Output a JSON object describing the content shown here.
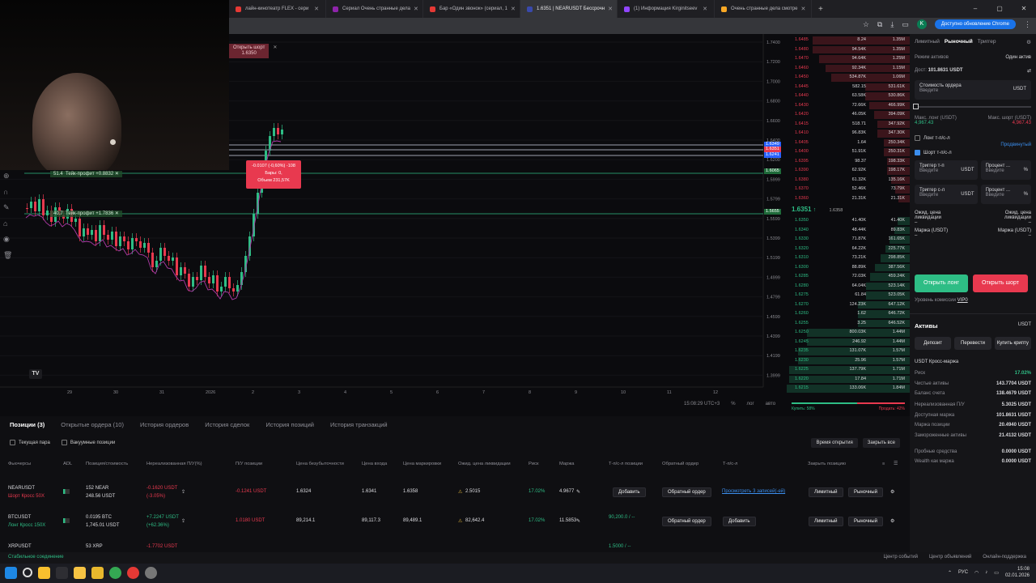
{
  "browser": {
    "tabs": [
      {
        "label": "лайн-кинотеатр FLEX - сери",
        "color": "#e53935",
        "active": false
      },
      {
        "label": "Сериал Очень странные дела",
        "color": "#8e24aa",
        "active": false
      },
      {
        "label": "Бар «Один звонок» (сериал, 1",
        "color": "#e53935",
        "active": false
      },
      {
        "label": "1.6351 | NEARUSDT Бессрочн",
        "color": "#3949ab",
        "active": true
      },
      {
        "label": "(1) Информация Kirginitseev",
        "color": "#9146ff",
        "active": false
      },
      {
        "label": "Очень странные дела смотре",
        "color": "#f9a825",
        "active": false
      }
    ],
    "new_tab_icon": "plus-icon",
    "update_label": "Доступно обновление Chrome",
    "profile_letter": "K"
  },
  "chart": {
    "open_short_label": "Открыть шорт",
    "open_short_price": "1.6350",
    "tooltip": {
      "line1": "-0.0107 (-0,60%) -108",
      "line2": "Бары: 0,",
      "line3": "Объем 231,57K"
    },
    "take_profit_1": {
      "qty": "51.4",
      "label": "Тейк-профит +0.8832"
    },
    "take_profit_2": {
      "qty": "40.7",
      "label": "Тейк-профит +1.7836"
    },
    "y_ticks": [
      "1.7400",
      "1.7200",
      "1.7000",
      "1.6800",
      "1.6600",
      "1.6400",
      "1.6200",
      "1.5999",
      "1.5799",
      "1.5599",
      "1.5399",
      "1.5199",
      "1.4999",
      "1.4799",
      "1.4599",
      "1.4399",
      "1.4199",
      "1.3999"
    ],
    "x_ticks": [
      "29",
      "30",
      "31",
      "2026",
      "2",
      "3",
      "4",
      "5",
      "6",
      "7",
      "8",
      "9",
      "10",
      "11",
      "12"
    ],
    "badges": [
      {
        "text": "1.6349",
        "color": "#2962ff"
      },
      {
        "text": "1.6351",
        "color": "#e8394f"
      },
      {
        "text": "1.6241",
        "color": "#2962ff"
      },
      {
        "text": "1.6065",
        "color": "#1f6b3a"
      },
      {
        "text": "1.5655",
        "color": "#1f6b3a"
      }
    ],
    "time_label": "15:08:29 UTC+3",
    "pct_label": "%",
    "log_label": "лог",
    "auto_label": "авто",
    "logo": "TV"
  },
  "orderbook": {
    "asks": [
      {
        "price": "1.6485",
        "qty": "8.24",
        "total": "1.35M"
      },
      {
        "price": "1.6480",
        "qty": "94.54K",
        "total": "1.35M"
      },
      {
        "price": "1.6470",
        "qty": "94.64K",
        "total": "1.25M"
      },
      {
        "price": "1.6460",
        "qty": "92.34K",
        "total": "1.15M"
      },
      {
        "price": "1.6450",
        "qty": "534.87K",
        "total": "1.06M"
      },
      {
        "price": "1.6445",
        "qty": "582.15",
        "total": "531.61K"
      },
      {
        "price": "1.6440",
        "qty": "63.58K",
        "total": "530.86K"
      },
      {
        "price": "1.6430",
        "qty": "72.66K",
        "total": "466.99K"
      },
      {
        "price": "1.6420",
        "qty": "46.05K",
        "total": "394.09K"
      },
      {
        "price": "1.6415",
        "qty": "518.71",
        "total": "347.92K"
      },
      {
        "price": "1.6410",
        "qty": "96.83K",
        "total": "347.30K"
      },
      {
        "price": "1.6405",
        "qty": "1.64",
        "total": "250.34K"
      },
      {
        "price": "1.6400",
        "qty": "51.91K",
        "total": "250.31K"
      },
      {
        "price": "1.6395",
        "qty": "98.37",
        "total": "198.33K"
      },
      {
        "price": "1.6390",
        "qty": "62.92K",
        "total": "198.17K"
      },
      {
        "price": "1.6380",
        "qty": "61.32K",
        "total": "135.16K"
      },
      {
        "price": "1.6370",
        "qty": "52.46K",
        "total": "73.79K"
      },
      {
        "price": "1.6360",
        "qty": "21.31K",
        "total": "21.31K"
      }
    ],
    "last_price": "1.6351",
    "mark_price": "1.6358",
    "bids": [
      {
        "price": "1.6350",
        "qty": "41.40K",
        "total": "41.40K"
      },
      {
        "price": "1.6340",
        "qty": "48.44K",
        "total": "89.83K"
      },
      {
        "price": "1.6330",
        "qty": "71.87K",
        "total": "161.65K"
      },
      {
        "price": "1.6320",
        "qty": "64.22K",
        "total": "225.77K"
      },
      {
        "price": "1.6310",
        "qty": "73.21K",
        "total": "298.85K"
      },
      {
        "price": "1.6300",
        "qty": "88.89K",
        "total": "387.56K"
      },
      {
        "price": "1.6285",
        "qty": "72.03K",
        "total": "459.24K"
      },
      {
        "price": "1.6280",
        "qty": "64.04K",
        "total": "523.14K"
      },
      {
        "price": "1.6275",
        "qty": "61.84",
        "total": "523.05K"
      },
      {
        "price": "1.6270",
        "qty": "124.23K",
        "total": "647.12K"
      },
      {
        "price": "1.6260",
        "qty": "1.62",
        "total": "646.72K"
      },
      {
        "price": "1.6255",
        "qty": "3.25",
        "total": "646.52K"
      },
      {
        "price": "1.6250",
        "qty": "800.03K",
        "total": "1.44M"
      },
      {
        "price": "1.6245",
        "qty": "246.92",
        "total": "1.44M"
      },
      {
        "price": "1.6235",
        "qty": "131.07K",
        "total": "1.57M"
      },
      {
        "price": "1.6230",
        "qty": "25.96",
        "total": "1.57M"
      },
      {
        "price": "1.6225",
        "qty": "137.79K",
        "total": "1.71M"
      },
      {
        "price": "1.6220",
        "qty": "17.84",
        "total": "1.71M"
      },
      {
        "price": "1.6215",
        "qty": "133.06K",
        "total": "1.84M"
      }
    ],
    "buy_label": "Купить: 58%",
    "sell_label": "Продать: 42%"
  },
  "orderform": {
    "tabs": [
      "Лимитный",
      "Рыночный",
      "Триггер"
    ],
    "asset_mode_label": "Режим активов",
    "asset_mode_value": "Один актив",
    "available_label": "Дост:",
    "available_value": "101.8631 USDT",
    "order_value_label": "Стоимость ордера",
    "order_value_placeholder": "Введите",
    "order_value_unit": "USDT",
    "max_long_label": "Макс. лонг (USDT)",
    "max_long_value": "4,967.43",
    "max_short_label": "Макс. шорт (USDT)",
    "max_short_value": "4,967.43",
    "long_tpsl_label": "Лонг т-п/с-л",
    "advanced_label": "Продвинутый",
    "short_tpsl_label": "Шорт т-п/с-л",
    "tp_trigger_label": "Триггер т-п",
    "sl_trigger_label": "Триггер с-л",
    "trigger_placeholder": "Введите",
    "trigger_unit": "USDT",
    "percent_label": "Процент ...",
    "percent_unit": "%",
    "est_liq_label": "Ожид. цена ликвидации",
    "est_liq_value": "–",
    "margin_label": "Маржа (USDT)",
    "margin_value": "–",
    "open_long": "Открыть лонг",
    "open_short": "Открыть шорт",
    "fee_level_label": "Уровень комиссии",
    "fee_level_value": "VIP0",
    "assets_title": "Активы",
    "assets_currency": "USDT",
    "deposit": "Депозит",
    "transfer": "Перевести",
    "buy_crypto": "Купить крипту",
    "cross_margin_label": "USDT Кросс-маржа",
    "risk_label": "Риск",
    "risk_value": "17.02%",
    "net_assets_label": "Чистые активы",
    "net_assets_value": "143.7704 USDT",
    "balance_label": "Баланс счета",
    "balance_value": "138.4679 USDT",
    "unrealized_label": "Нереализованная П/У",
    "unrealized_value": "5.3025 USDT",
    "avail_margin_label": "Доступная маржа",
    "avail_margin_value": "101.8631 USDT",
    "pos_margin_label": "Маржа позиции",
    "pos_margin_value": "20.4940 USDT",
    "frozen_margin_label": "Замороженные активы",
    "frozen_margin_value": "21.4132 USDT",
    "bonus_label": "Пробные средства",
    "bonus_value": "0.0000 USDT",
    "wealth_label": "Wealth как маржа",
    "wealth_value": "0.0000 USDT"
  },
  "bottom": {
    "tabs": [
      "Позиции (3)",
      "Открытые ордера (10)",
      "История ордеров",
      "История сделок",
      "История позиций",
      "История транзакций"
    ],
    "filter_current_pair": "Текущая пара",
    "filter_hide_small": "Вакуумные позиции",
    "sort_label": "Время открытия",
    "close_all": "Закрыть все",
    "headers": [
      "Фьючерсы",
      "ADL",
      "Позиция/стоимость",
      "Нереализованная П/У(%)",
      "П/У позиции",
      "Цена безубыточности",
      "Цена входа",
      "Цена маркировки",
      "Ожид. цена ликвидации",
      "Риск",
      "Маржа",
      "Т-п/с-л позиции",
      "Обратный ордер",
      "Т-п/с-л",
      "Закрыть позицию"
    ],
    "rows": [
      {
        "symbol": "NEARUSDT",
        "mode": "Шорт  Кросс  50X",
        "pos": "152 NEAR",
        "value": "248.56 USDT",
        "upnl": "-0.1620 USDT",
        "upnl_pct": "(-3.05%)",
        "pnl": "-0.1241 USDT",
        "breakeven": "1.6324",
        "entry": "1.6341",
        "mark": "1.6358",
        "liq": "2.5015",
        "risk": "17.02%",
        "margin": "4.9677",
        "tpsl": "Добавить",
        "reverse": "Обратный ордер",
        "tpsl_link": "Просмотреть 3 записей(-ей)",
        "close_limit": "Лимитный",
        "close_market": "Рыночный"
      },
      {
        "symbol": "BTCUSDT",
        "mode": "Лонг  Кросс  150X",
        "pos": "0.0195 BTC",
        "value": "1,745.01 USDT",
        "upnl": "+7.2247 USDT",
        "upnl_pct": "(+62.36%)",
        "pnl": "1.0180 USDT",
        "breakeven": "89,214.1",
        "entry": "89,117.3",
        "mark": "89,489.1",
        "liq": "82,642.4",
        "risk": "17.02%",
        "margin": "11.5853",
        "tpsl": "90,200.0 / --",
        "reverse": "Обратный ордер",
        "tpsl_link": "Добавить",
        "close_limit": "Лимитный",
        "close_market": "Рыночный"
      },
      {
        "symbol": "XRPUSDT",
        "mode": "",
        "pos": "53 XRP",
        "value": "",
        "upnl": "-1.7702 USDT",
        "upnl_pct": "",
        "pnl": "",
        "breakeven": "",
        "entry": "",
        "mark": "",
        "liq": "",
        "risk": "",
        "margin": "",
        "tpsl": "1.5000 / --",
        "reverse": "",
        "tpsl_link": "",
        "close_limit": "",
        "close_market": ""
      }
    ]
  },
  "statusbar": {
    "connection": "Стабильное соединение",
    "events": "Центр событий",
    "announcements": "Центр объявлений",
    "support": "Онлайн-поддержка"
  },
  "taskbar": {
    "lang": "РУС",
    "time": "15:08",
    "date": "02.01.2026"
  }
}
